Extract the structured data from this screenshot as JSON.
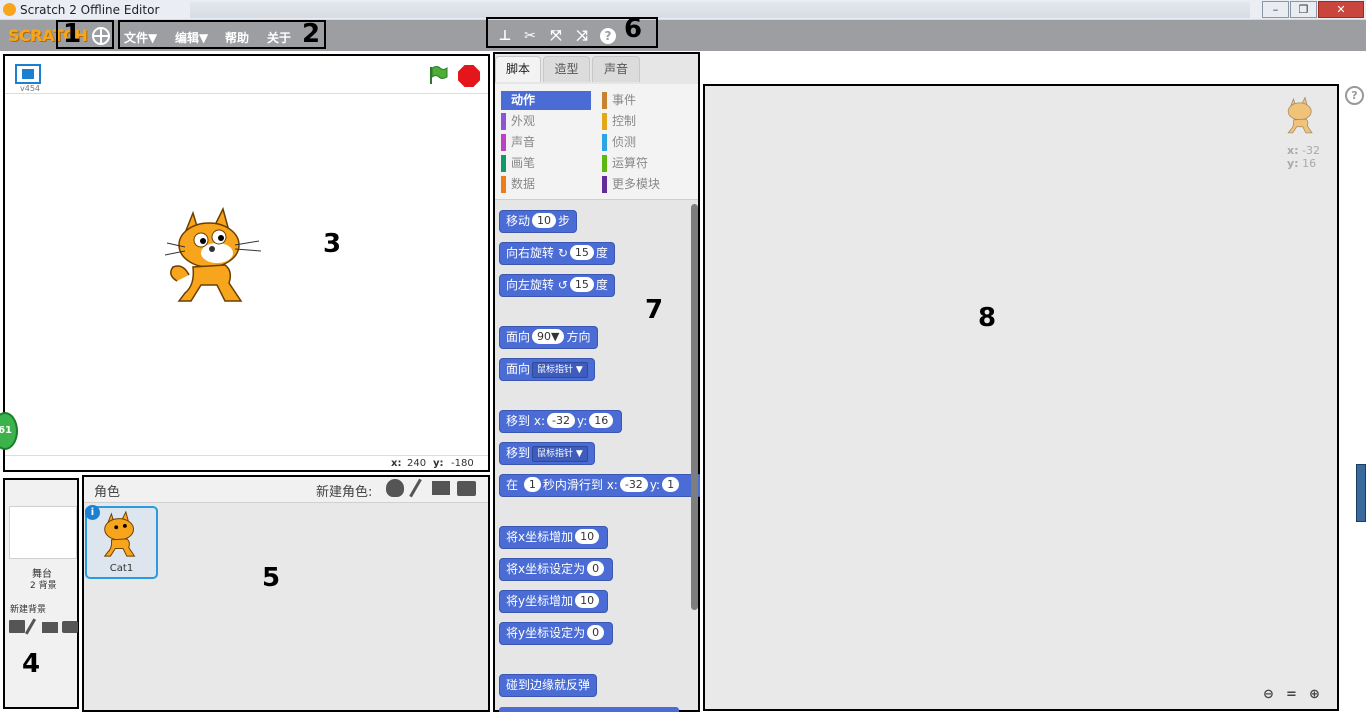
{
  "window": {
    "title": "Scratch 2 Offline Editor",
    "controls": [
      "–",
      "❐",
      "✕"
    ]
  },
  "menubar": {
    "logo": "SCRATCH",
    "menus": [
      "文件▼",
      "编辑▼",
      "帮助",
      "关于"
    ],
    "tools": [
      "duplicate-icon",
      "cut-icon",
      "grow-icon",
      "shrink-icon",
      "help-icon"
    ]
  },
  "callouts": [
    "1",
    "2",
    "3",
    "4",
    "5",
    "6",
    "7",
    "8"
  ],
  "stage": {
    "version": "v454",
    "x_label": "x:",
    "x_value": "240",
    "y_label": "y:",
    "y_value": "-180",
    "badge": "61"
  },
  "stage_panel": {
    "name": "舞台",
    "count": "2 背景",
    "new_backdrop": "新建背景"
  },
  "sprite_panel": {
    "title": "角色",
    "new_sprite": "新建角色:",
    "sprites": [
      {
        "name": "Cat1"
      }
    ]
  },
  "palette": {
    "tabs": [
      "脚本",
      "造型",
      "声音"
    ],
    "categories_left": [
      {
        "label": "动作",
        "color": "#4a6cd4",
        "active": true
      },
      {
        "label": "外观",
        "color": "#8a55d7"
      },
      {
        "label": "声音",
        "color": "#bb42c3"
      },
      {
        "label": "画笔",
        "color": "#0e9a6c"
      },
      {
        "label": "数据",
        "color": "#ee7d16"
      }
    ],
    "categories_right": [
      {
        "label": "事件",
        "color": "#c88330"
      },
      {
        "label": "控制",
        "color": "#e1a91a"
      },
      {
        "label": "侦测",
        "color": "#2ca5e2"
      },
      {
        "label": "运算符",
        "color": "#5cb712"
      },
      {
        "label": "更多模块",
        "color": "#632d99"
      }
    ],
    "blocks": {
      "move": {
        "pre": "移动",
        "val": "10",
        "post": "步"
      },
      "turn_right": {
        "pre": "向右旋转",
        "icon": "↻",
        "val": "15",
        "post": "度"
      },
      "turn_left": {
        "pre": "向左旋转",
        "icon": "↺",
        "val": "15",
        "post": "度"
      },
      "point_dir": {
        "pre": "面向",
        "val": "90▼",
        "post": "方向"
      },
      "point_towards": {
        "pre": "面向",
        "dd": "鼠标指针 ▼"
      },
      "goto_xy": {
        "pre": "移到",
        "x": "x:",
        "xval": "-32",
        "y": "y:",
        "yval": "16"
      },
      "goto": {
        "pre": "移到",
        "dd": "鼠标指针 ▼"
      },
      "glide": {
        "pre": "在",
        "secs": "1",
        "mid": "秒内滑行到",
        "x": "x:",
        "xval": "-32",
        "y": "y:",
        "yval": "1"
      },
      "change_x": {
        "pre": "将x坐标增加",
        "val": "10"
      },
      "set_x": {
        "pre": "将x坐标设定为",
        "val": "0"
      },
      "change_y": {
        "pre": "将y坐标增加",
        "val": "10"
      },
      "set_y": {
        "pre": "将y坐标设定为",
        "val": "0"
      },
      "bounce": {
        "pre": "碰到边缘就反弹"
      }
    }
  },
  "scripts": {
    "x_label": "x:",
    "x_value": "-32",
    "y_label": "y:",
    "y_value": "16"
  },
  "colors": {
    "menubar": "#9c9ea2",
    "motion": "#4a6cd4",
    "callout": "#000000"
  }
}
